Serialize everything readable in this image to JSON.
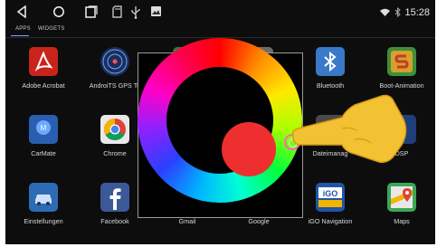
{
  "status": {
    "time": "15:28"
  },
  "tabs": [
    {
      "label": "APPS",
      "active": true
    },
    {
      "label": "WIDGETS",
      "active": false
    }
  ],
  "apps": [
    {
      "label": "Adobe Acrobat",
      "icon": "adobe-acrobat-icon",
      "color": "#c8241c"
    },
    {
      "label": "AndroiTS GPS Te",
      "icon": "gps-test-icon",
      "color": "#1b2e5c"
    },
    {
      "label": "",
      "icon": "hidden-app-icon",
      "color": "#2f7d32"
    },
    {
      "label": "",
      "icon": "hidden-app-icon",
      "color": "#6d6d6d"
    },
    {
      "label": "Bluetooth",
      "icon": "bluetooth-icon",
      "color": "#3a78c8"
    },
    {
      "label": "Boot-Animation",
      "icon": "boot-animation-icon",
      "color": "#3c8f3c"
    },
    {
      "label": "CarMate",
      "icon": "carmate-icon",
      "color": "#2a5fb0"
    },
    {
      "label": "Chrome",
      "icon": "chrome-icon",
      "color": "#e8e8e8"
    },
    {
      "label": "",
      "icon": "hidden-app-icon",
      "color": "#555555"
    },
    {
      "label": "",
      "icon": "hidden-app-icon",
      "color": "#555555"
    },
    {
      "label": "Dateimanag",
      "icon": "file-manager-icon",
      "color": "#4a4a4a"
    },
    {
      "label": "DSP",
      "icon": "dsp-icon",
      "color": "#1f3f7a"
    },
    {
      "label": "Einstellungen",
      "icon": "settings-car-icon",
      "color": "#2d6bb5"
    },
    {
      "label": "Facebook",
      "icon": "facebook-icon",
      "color": "#3b5998"
    },
    {
      "label": "Gmail",
      "icon": "gmail-icon",
      "color": "#e8e8e8"
    },
    {
      "label": "Google",
      "icon": "google-icon",
      "color": "#e8e8e8"
    },
    {
      "label": "iGO Navigation",
      "icon": "igo-navigation-icon",
      "color": "#1e56a6"
    },
    {
      "label": "Maps",
      "icon": "maps-icon",
      "color": "#3aa757"
    }
  ],
  "color_picker": {
    "selected_color": "#ef2f2f"
  }
}
